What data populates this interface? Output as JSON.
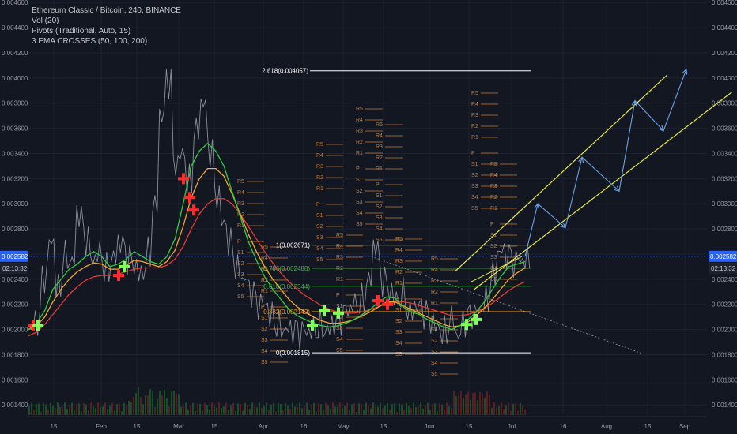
{
  "chart_data": {
    "type": "line",
    "title": "Ethereum Classic / Bitcoin, 240, BINANCE",
    "indicators": [
      "Vol (20)",
      "Pivots (Traditional, Auto, 15)",
      "3 EMA CROSSES (50, 100, 200)"
    ],
    "ylim": [
      0.00132,
      0.00462
    ],
    "y_ticks": [
      "0.004600",
      "0.004400",
      "0.004200",
      "0.004000",
      "0.003800",
      "0.003600",
      "0.003400",
      "0.003200",
      "0.003000",
      "0.002800",
      "0.002600",
      "0.002400",
      "0.002200",
      "0.002000",
      "0.001800",
      "0.001600",
      "0.001400"
    ],
    "x_ticks": [
      "15",
      "Feb",
      "15",
      "Mar",
      "15",
      "Apr",
      "16",
      "May",
      "15",
      "Jun",
      "15",
      "Jul",
      "16",
      "Aug",
      "15",
      "Sep"
    ],
    "last_price": "0.002582",
    "countdown": "02:13:32",
    "fib_levels": [
      {
        "label": "2.618(0.004057)",
        "value": 0.004057,
        "color": "#ffffff"
      },
      {
        "label": "1(0.002671)",
        "value": 0.002671,
        "color": "#ffffff"
      },
      {
        "label": "0.786(0.002488)",
        "value": 0.002488,
        "color": "#4caf50"
      },
      {
        "label": "0.618(0.002344)",
        "value": 0.002344,
        "color": "#4caf50"
      },
      {
        "label": "0.382(0.002142)",
        "value": 0.002142,
        "color": "#ff9800"
      },
      {
        "label": "0(0.001815)",
        "value": 0.001815,
        "color": "#ffffff"
      }
    ],
    "pivot_labels": [
      "R5",
      "R4",
      "R3",
      "R2",
      "R1",
      "P",
      "S1",
      "S2",
      "S3",
      "S4",
      "S5"
    ],
    "price_series_approx": [
      0.002,
      0.00205,
      0.0024,
      0.0027,
      0.00235,
      0.0026,
      0.00255,
      0.0029,
      0.0027,
      0.00255,
      0.00262,
      0.0025,
      0.00258,
      0.00268,
      0.00255,
      0.0025,
      0.00245,
      0.00262,
      0.003,
      0.0037,
      0.00395,
      0.0033,
      0.0034,
      0.0032,
      0.0036,
      0.0038,
      0.0034,
      0.00305,
      0.00285,
      0.0027,
      0.0025,
      0.0024,
      0.00228,
      0.00218,
      0.0022,
      0.00212,
      0.00205,
      0.002,
      0.00198,
      0.00195,
      0.00198,
      0.00202,
      0.00205,
      0.002,
      0.00203,
      0.00207,
      0.00215,
      0.00222,
      0.00225,
      0.0024,
      0.00265,
      0.00238,
      0.0023,
      0.00225,
      0.0023,
      0.00215,
      0.00218,
      0.00212,
      0.00205,
      0.00202,
      0.002,
      0.0021,
      0.00195,
      0.00205,
      0.0021,
      0.00215,
      0.00225,
      0.00245,
      0.00262,
      0.00258,
      0.00252,
      0.00255,
      0.00258
    ],
    "ema_green_approx": [
      0.002,
      0.00205,
      0.00215,
      0.00232,
      0.0024,
      0.00248,
      0.00252,
      0.00258,
      0.00262,
      0.00258,
      0.0025,
      0.00252,
      0.00256,
      0.00262,
      0.00258,
      0.00254,
      0.00252,
      0.00258,
      0.00272,
      0.003,
      0.0033,
      0.00342,
      0.00348,
      0.00342,
      0.0033,
      0.0031,
      0.0029,
      0.0027,
      0.00255,
      0.00242,
      0.00232,
      0.00224,
      0.00216,
      0.00211,
      0.00208,
      0.00205,
      0.00203,
      0.00202,
      0.00203,
      0.00205,
      0.00208,
      0.00212,
      0.00216,
      0.00222,
      0.00226,
      0.00225,
      0.00218,
      0.00214,
      0.00212,
      0.00208,
      0.00205,
      0.00202,
      0.002,
      0.00203,
      0.00208,
      0.00214,
      0.00222,
      0.00232,
      0.00242,
      0.0025,
      0.00252,
      0.00254
    ],
    "ema_orange_approx": [
      0.002,
      0.00203,
      0.0021,
      0.00222,
      0.00232,
      0.0024,
      0.00246,
      0.0025,
      0.00253,
      0.00252,
      0.00248,
      0.00248,
      0.00251,
      0.00255,
      0.00254,
      0.00252,
      0.0025,
      0.00254,
      0.00263,
      0.00282,
      0.00305,
      0.0032,
      0.00328,
      0.00328,
      0.00322,
      0.00308,
      0.00292,
      0.00276,
      0.00262,
      0.0025,
      0.0024,
      0.00232,
      0.00224,
      0.00218,
      0.00214,
      0.0021,
      0.00207,
      0.00205,
      0.00205,
      0.00206,
      0.00208,
      0.00211,
      0.00214,
      0.00218,
      0.00222,
      0.00222,
      0.00219,
      0.00216,
      0.00213,
      0.0021,
      0.00207,
      0.00204,
      0.00202,
      0.00203,
      0.00206,
      0.00211,
      0.00217,
      0.00224,
      0.00232,
      0.0024,
      0.00245,
      0.00249
    ],
    "ema_red_approx": [
      0.00195,
      0.00198,
      0.00204,
      0.00212,
      0.0022,
      0.00228,
      0.00234,
      0.00239,
      0.00242,
      0.00243,
      0.00243,
      0.00244,
      0.00246,
      0.00248,
      0.00249,
      0.00249,
      0.00249,
      0.00251,
      0.00256,
      0.00266,
      0.0028,
      0.00292,
      0.003,
      0.00304,
      0.00304,
      0.003,
      0.00292,
      0.00282,
      0.00272,
      0.00262,
      0.00253,
      0.00245,
      0.00238,
      0.00232,
      0.00227,
      0.00223,
      0.00219,
      0.00216,
      0.00214,
      0.00213,
      0.00213,
      0.00214,
      0.00216,
      0.00218,
      0.00221,
      0.00222,
      0.00222,
      0.00221,
      0.00219,
      0.00217,
      0.00215,
      0.00213,
      0.00211,
      0.00211,
      0.00212,
      0.00214,
      0.00217,
      0.00221,
      0.00226,
      0.00231,
      0.00235,
      0.00238
    ],
    "colors": {
      "background": "#131722",
      "grid": "#1e2230",
      "price": "#8a8e99",
      "ema_green": "#2ecc40",
      "ema_orange": "#f5a623",
      "ema_red": "#e53935",
      "pivot": "#c87a2f",
      "channel": "#e8e83a",
      "arrows": "#6aa0e0",
      "last_price_bg": "#2962ff",
      "cross_green": "#7fff5a",
      "cross_red": "#ff2b2b",
      "volume_green": "#1d5c2a",
      "volume_red": "#6b1f1f"
    }
  }
}
